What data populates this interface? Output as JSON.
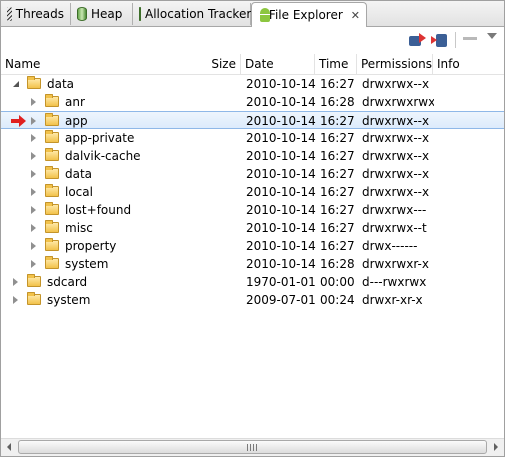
{
  "tabs": [
    {
      "label": "Threads",
      "icon": "threads-icon"
    },
    {
      "label": "Heap",
      "icon": "heap-icon"
    },
    {
      "label": "Allocation Tracker",
      "icon": "allocation-icon"
    },
    {
      "label": "File Explorer",
      "icon": "android-icon",
      "active": true,
      "close": "✕"
    }
  ],
  "toolbar": {
    "push_icon": "push-file-icon",
    "pull_icon": "pull-file-icon",
    "minimize_icon": "minimize-icon",
    "menu_icon": "view-menu-icon"
  },
  "columns": {
    "name": "Name",
    "size": "Size",
    "date": "Date",
    "time": "Time",
    "permissions": "Permissions",
    "info": "Info"
  },
  "rows": [
    {
      "name": "data",
      "size": "",
      "date": "2010-10-14",
      "time": "16:27",
      "permissions": "drwxrwx--x",
      "info": "",
      "level": 0,
      "expanded": true
    },
    {
      "name": "anr",
      "size": "",
      "date": "2010-10-14",
      "time": "16:28",
      "permissions": "drwxrwxrwx",
      "info": "",
      "level": 1,
      "expanded": false
    },
    {
      "name": "app",
      "size": "",
      "date": "2010-10-14",
      "time": "16:27",
      "permissions": "drwxrwx--x",
      "info": "",
      "level": 1,
      "expanded": false,
      "selected": true,
      "marker": "red-arrow-icon"
    },
    {
      "name": "app-private",
      "size": "",
      "date": "2010-10-14",
      "time": "16:27",
      "permissions": "drwxrwx--x",
      "info": "",
      "level": 1,
      "expanded": false
    },
    {
      "name": "dalvik-cache",
      "size": "",
      "date": "2010-10-14",
      "time": "16:27",
      "permissions": "drwxrwx--x",
      "info": "",
      "level": 1,
      "expanded": false
    },
    {
      "name": "data",
      "size": "",
      "date": "2010-10-14",
      "time": "16:27",
      "permissions": "drwxrwx--x",
      "info": "",
      "level": 1,
      "expanded": false
    },
    {
      "name": "local",
      "size": "",
      "date": "2010-10-14",
      "time": "16:27",
      "permissions": "drwxrwx--x",
      "info": "",
      "level": 1,
      "expanded": false
    },
    {
      "name": "lost+found",
      "size": "",
      "date": "2010-10-14",
      "time": "16:27",
      "permissions": "drwxrwx---",
      "info": "",
      "level": 1,
      "expanded": false
    },
    {
      "name": "misc",
      "size": "",
      "date": "2010-10-14",
      "time": "16:27",
      "permissions": "drwxrwx--t",
      "info": "",
      "level": 1,
      "expanded": false
    },
    {
      "name": "property",
      "size": "",
      "date": "2010-10-14",
      "time": "16:27",
      "permissions": "drwx------",
      "info": "",
      "level": 1,
      "expanded": false
    },
    {
      "name": "system",
      "size": "",
      "date": "2010-10-14",
      "time": "16:28",
      "permissions": "drwxrwxr-x",
      "info": "",
      "level": 1,
      "expanded": false
    },
    {
      "name": "sdcard",
      "size": "",
      "date": "1970-01-01",
      "time": "00:00",
      "permissions": "d---rwxrwx",
      "info": "",
      "level": 0,
      "expanded": false
    },
    {
      "name": "system",
      "size": "",
      "date": "2009-07-01",
      "time": "00:24",
      "permissions": "drwxr-xr-x",
      "info": "",
      "level": 0,
      "expanded": false
    }
  ],
  "colors": {
    "selection": "#dcebfc",
    "selection_border": "#8fb8e8",
    "marker": "#e02020",
    "folder": "#f2c24a"
  }
}
